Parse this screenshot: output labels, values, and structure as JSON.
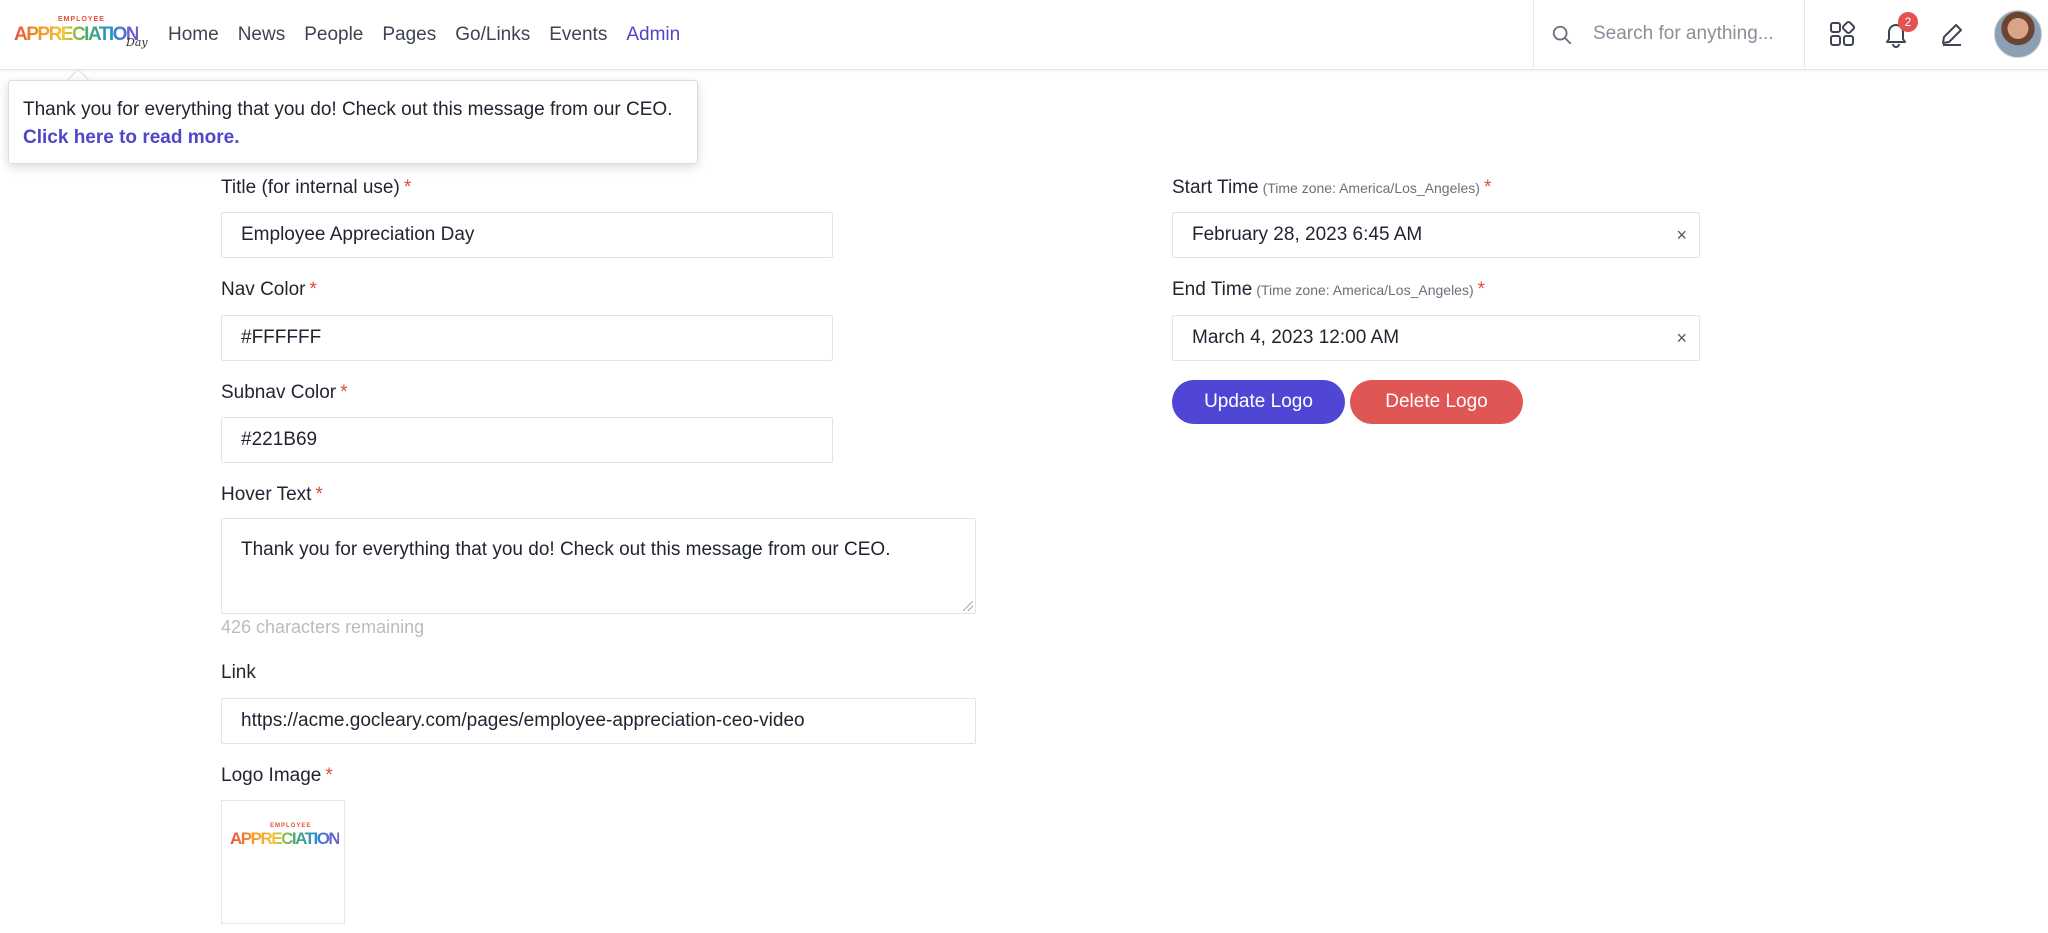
{
  "nav": {
    "logo": {
      "top": "EMPLOYEE",
      "main": "APPRECIATION",
      "script": "Day"
    },
    "links": [
      "Home",
      "News",
      "People",
      "Pages",
      "Go/Links",
      "Events",
      "Admin"
    ],
    "active": "Admin",
    "search_placeholder": "Search for anything...",
    "notification_count": "2"
  },
  "tooltip": {
    "text": "Thank you for everything that you do! Check out this message from our CEO.",
    "link_text": "Click here to read more."
  },
  "form": {
    "title": {
      "label": "Title (for internal use)",
      "value": "Employee Appreciation Day"
    },
    "nav_color": {
      "label": "Nav Color",
      "value": "#FFFFFF"
    },
    "subnav_color": {
      "label": "Subnav Color",
      "value": "#221B69"
    },
    "hover_text": {
      "label": "Hover Text",
      "value": "Thank you for everything that you do! Check out this message from our CEO.",
      "helper": "426 characters remaining"
    },
    "link": {
      "label": "Link",
      "value": "https://acme.gocleary.com/pages/employee-appreciation-ceo-video"
    },
    "logo_image": {
      "label": "Logo Image"
    },
    "start_time": {
      "label": "Start Time",
      "tz": "(Time zone: America/Los_Angeles)",
      "value": "February 28, 2023 6:45 AM"
    },
    "end_time": {
      "label": "End Time",
      "tz": "(Time zone: America/Los_Angeles)",
      "value": "March 4, 2023 12:00 AM"
    },
    "required_mark": "*",
    "clear_glyph": "×",
    "update_logo": "Update Logo",
    "delete_logo": "Delete Logo"
  },
  "colors": {
    "accent": "#4f46d6",
    "danger": "#e05655",
    "required": "#e04c3b"
  }
}
